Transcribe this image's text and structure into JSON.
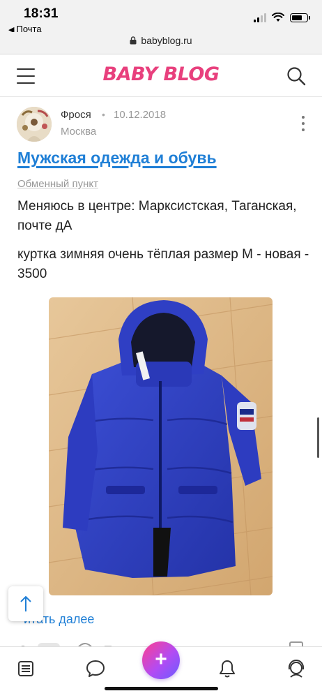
{
  "status_bar": {
    "time": "18:31",
    "back_label": "Почта"
  },
  "browser": {
    "url": "babyblog.ru"
  },
  "header": {
    "logo_text": "BABY BLOG",
    "brand_color": "#e8407d"
  },
  "post": {
    "author": "Фрося",
    "separator": "•",
    "date": "10.12.2018",
    "city": "Москва",
    "title": "Мужская одежда и обувь",
    "category": "Обменный пункт",
    "paragraphs": [
      "Меняюсь в центре: Марксистская, Таганская, почте дА",
      "куртка зимняя очень тёплая размер М - новая - 3500"
    ],
    "read_more": "итать далее",
    "link_color": "#1f7fd6"
  },
  "icons": {
    "menu": "hamburger-icon",
    "search": "search-icon",
    "more": "more-vertical-icon",
    "scroll_top": "arrow-up-icon",
    "nav": [
      "feed-icon",
      "chat-icon",
      "plus-icon",
      "bell-icon",
      "profile-icon"
    ]
  }
}
